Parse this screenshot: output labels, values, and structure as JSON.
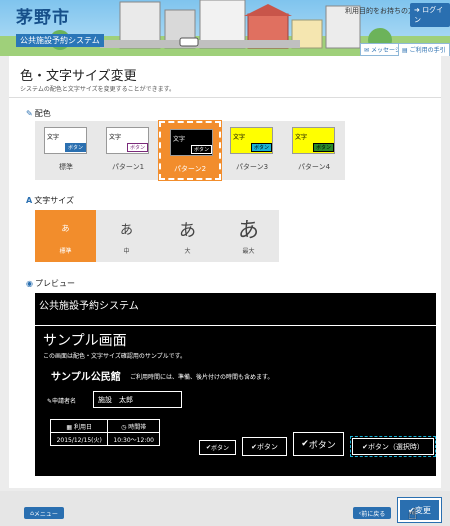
{
  "header": {
    "app_title": "茅野市",
    "app_subtitle": "公共施設予約システム",
    "welcome": "利用目的をお持ちの方",
    "login_label": "ログイン",
    "message_label": "メッセージ",
    "help_label": "ご利用の手引き"
  },
  "page": {
    "title": "色・文字サイズ変更",
    "description": "システムの配色と文字サイズを変更することができます。"
  },
  "color_section": {
    "title": "配色",
    "icon": "brush-icon",
    "sample_text": "文字",
    "sample_button": "ボタン",
    "options": [
      {
        "label": "標準",
        "bg": "#ffffff",
        "text": "#000000",
        "btn_bg": "#2a6fb0",
        "btn_text": "#ffffff",
        "btn_border": "#2a6fb0"
      },
      {
        "label": "パターン1",
        "bg": "#ffffff",
        "text": "#000000",
        "btn_bg": "#ffffff",
        "btn_text": "#7a2a7a",
        "btn_border": "#7a2a7a"
      },
      {
        "label": "パターン2",
        "bg": "#000000",
        "text": "#ffffff",
        "btn_bg": "#000000",
        "btn_text": "#ffffff",
        "btn_border": "#ffffff"
      },
      {
        "label": "パターン3",
        "bg": "#ffff00",
        "text": "#000000",
        "btn_bg": "#19b3d6",
        "btn_text": "#000000",
        "btn_border": "#000000"
      },
      {
        "label": "パターン4",
        "bg": "#ffff00",
        "text": "#000000",
        "btn_bg": "#2a8a2a",
        "btn_text": "#000000",
        "btn_border": "#000000"
      }
    ],
    "selected_index": 2
  },
  "size_section": {
    "title": "文字サイズ",
    "icon": "font-icon",
    "glyph": "あ",
    "options": [
      {
        "label": "標準"
      },
      {
        "label": "中"
      },
      {
        "label": "大"
      },
      {
        "label": "最大"
      }
    ],
    "selected_index": 0
  },
  "preview_section": {
    "title": "プレビュー",
    "icon": "eye-icon",
    "system_title": "公共施設予約システム",
    "screen_heading": "サンプル画面",
    "screen_desc": "この画面は配色・文字サイズ確認用のサンプルです。",
    "facility_name": "サンプル公民館",
    "facility_note": "ご利用時間には、準備、後片付けの時間も含めます。",
    "applicant_label": "申請者名",
    "applicant_value": "施設　太郎",
    "usage_date_label": "利用日",
    "time_slot_label": "時間帯",
    "usage_date": "2015/12/15(火)",
    "time_slot": "10:30～12:00",
    "buttons": [
      "ボタン",
      "ボタン",
      "ボタン",
      "ボタン（選択時）"
    ]
  },
  "footer": {
    "menu_label": "メニュー",
    "back_label": "前に戻る",
    "change_label": "変更"
  },
  "colors": {
    "accent": "#f28d2c",
    "primary": "#2a6fb0"
  }
}
